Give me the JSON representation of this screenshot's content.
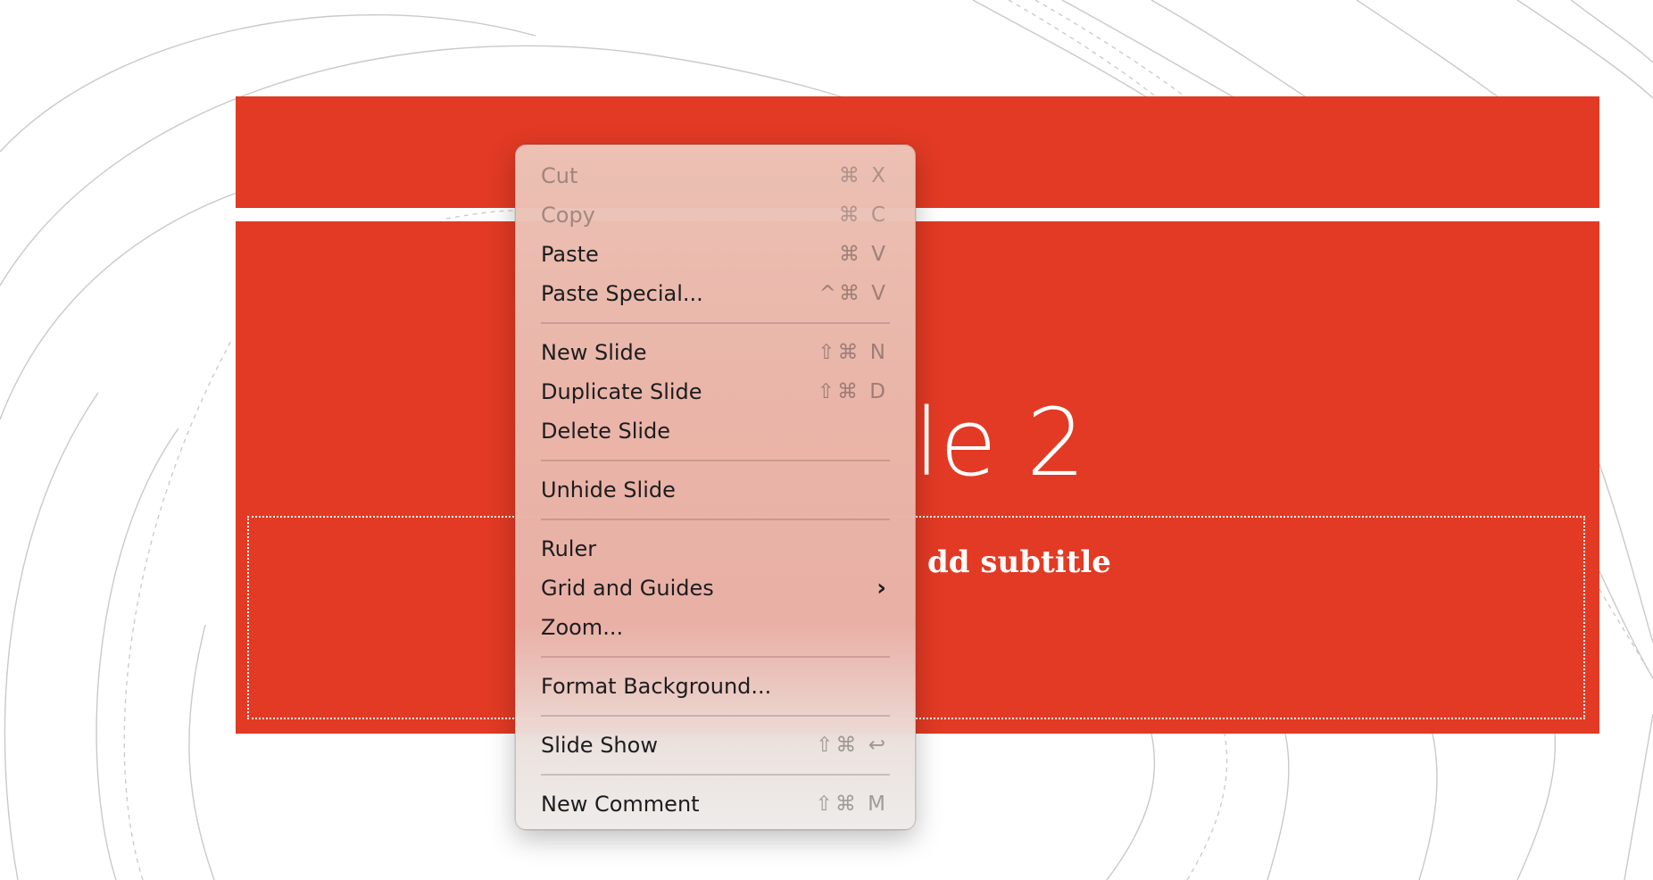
{
  "colors": {
    "slide_red": "#E23A24",
    "bg_line": "#c9c9c9",
    "white": "#ffffff"
  },
  "slide": {
    "title_visible": "le 2",
    "subtitle_visible": "dd subtitle"
  },
  "context_menu": {
    "sections": [
      {
        "items": [
          {
            "label": "Cut",
            "shortcut": "⌘ X",
            "disabled": true
          },
          {
            "label": "Copy",
            "shortcut": "⌘ C",
            "disabled": true
          },
          {
            "label": "Paste",
            "shortcut": "⌘ V",
            "disabled": false
          },
          {
            "label": "Paste Special...",
            "shortcut": "^⌘ V",
            "disabled": false
          }
        ]
      },
      {
        "items": [
          {
            "label": "New Slide",
            "shortcut": "⇧⌘ N",
            "disabled": false
          },
          {
            "label": "Duplicate Slide",
            "shortcut": "⇧⌘ D",
            "disabled": false
          },
          {
            "label": "Delete Slide",
            "shortcut": "",
            "disabled": false
          }
        ]
      },
      {
        "items": [
          {
            "label": "Unhide Slide",
            "shortcut": "",
            "disabled": false
          }
        ]
      },
      {
        "items": [
          {
            "label": "Ruler",
            "shortcut": "",
            "disabled": false
          },
          {
            "label": "Grid and Guides",
            "shortcut": "",
            "disabled": false,
            "submenu": true,
            "submenu_icon": "chevron-right-icon"
          },
          {
            "label": "Zoom...",
            "shortcut": "",
            "disabled": false
          }
        ]
      },
      {
        "items": [
          {
            "label": "Format Background...",
            "shortcut": "",
            "disabled": false
          }
        ]
      },
      {
        "items": [
          {
            "label": "Slide Show",
            "shortcut": "⇧⌘ ↩",
            "disabled": false
          }
        ]
      },
      {
        "items": [
          {
            "label": "New Comment",
            "shortcut": "⇧⌘ M",
            "disabled": false
          }
        ]
      }
    ]
  }
}
